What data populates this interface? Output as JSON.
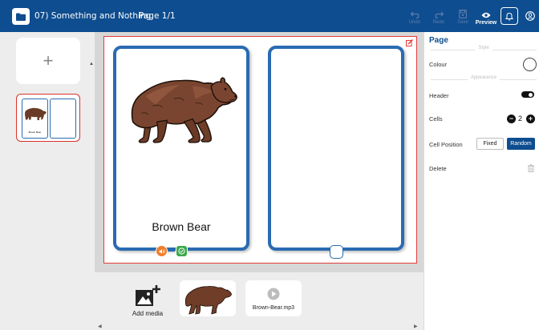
{
  "topbar": {
    "project_title": "07) Something and Nothing",
    "page_indicator": "Page 1/1",
    "undo_label": "Undo",
    "redo_label": "Redo",
    "save_label": "Save",
    "preview_label": "Preview"
  },
  "sidebar": {
    "add_page_symbol": "+",
    "thumbnail_label": "Brown Bear"
  },
  "canvas": {
    "card_left_label": "Brown Bear",
    "card_right_label": ""
  },
  "media": {
    "add_media_label": "Add media",
    "audio_file": "Brown-Bear.mp3"
  },
  "panel": {
    "title": "Page",
    "style_section": "Style",
    "colour_label": "Colour",
    "appearance_section": "Appearance",
    "header_label": "Header",
    "cells_label": "Cells",
    "cells_value": "2",
    "cell_position_label": "Cell Position",
    "fixed_label": "Fixed",
    "random_label": "Random",
    "delete_label": "Delete"
  },
  "colors": {
    "topbar": "#0e4d8f",
    "card_border": "#2a6bb2",
    "page_border": "#e23b3b",
    "audio_badge": "#f07d2a",
    "check_badge": "#3aa84a"
  },
  "icons": [
    "folder-icon",
    "undo-icon",
    "redo-icon",
    "save-icon",
    "eye-icon",
    "bell-icon",
    "user-icon",
    "edit-icon",
    "speaker-icon",
    "check-icon",
    "add-media-icon",
    "play-icon",
    "trash-icon"
  ]
}
